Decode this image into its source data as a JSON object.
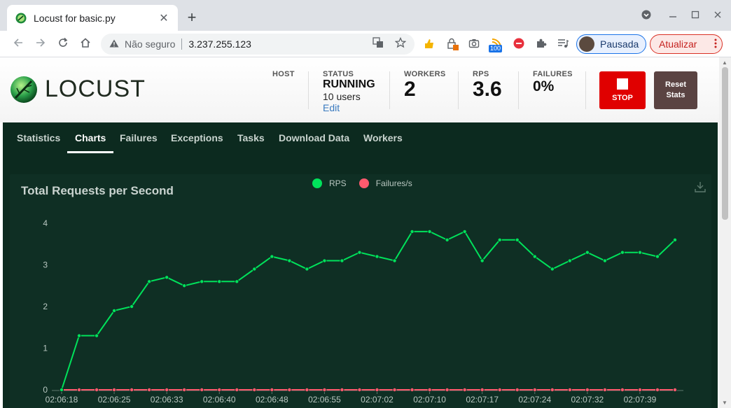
{
  "browser": {
    "tab_title": "Locust for basic.py",
    "tab_close": "✕",
    "new_tab": "+",
    "omnibox": {
      "security_label": "Não seguro",
      "url": "3.237.255.123"
    },
    "ext_badge": "100",
    "profile_label": "Pausada",
    "update_label": "Atualizar"
  },
  "header": {
    "logo_text": "LOCUST",
    "host": {
      "label": "HOST"
    },
    "status": {
      "label": "STATUS",
      "value": "RUNNING",
      "users": "10 users",
      "edit": "Edit"
    },
    "workers": {
      "label": "WORKERS",
      "value": "2"
    },
    "rps": {
      "label": "RPS",
      "value": "3.6"
    },
    "failures": {
      "label": "FAILURES",
      "value": "0%"
    },
    "stop_label": "STOP",
    "reset_label_1": "Reset",
    "reset_label_2": "Stats"
  },
  "nav": {
    "tabs": [
      {
        "label": "Statistics"
      },
      {
        "label": "Charts"
      },
      {
        "label": "Failures"
      },
      {
        "label": "Exceptions"
      },
      {
        "label": "Tasks"
      },
      {
        "label": "Download Data"
      },
      {
        "label": "Workers"
      }
    ],
    "active": "Charts"
  },
  "chart_data": {
    "type": "line",
    "title": "Total Requests per Second",
    "x_tick_labels": [
      "02:06:18",
      "02:06:25",
      "02:06:33",
      "02:06:40",
      "02:06:48",
      "02:06:55",
      "02:07:02",
      "02:07:10",
      "02:07:17",
      "02:07:24",
      "02:07:32",
      "02:07:39"
    ],
    "ylim": [
      0,
      4
    ],
    "y_ticks": [
      0,
      1,
      2,
      3,
      4
    ],
    "legend_position": "top-center",
    "series": [
      {
        "name": "RPS",
        "color": "#00e25b",
        "values": [
          0,
          1.3,
          1.3,
          1.9,
          2.0,
          2.6,
          2.7,
          2.5,
          2.6,
          2.6,
          2.6,
          2.9,
          3.2,
          3.1,
          2.9,
          3.1,
          3.1,
          3.3,
          3.2,
          3.1,
          3.8,
          3.8,
          3.6,
          3.8,
          3.1,
          3.6,
          3.6,
          3.2,
          2.9,
          3.1,
          3.3,
          3.1,
          3.3,
          3.3,
          3.2,
          3.6
        ]
      },
      {
        "name": "Failures/s",
        "color": "#ff5a6e",
        "values": [
          0,
          0,
          0,
          0,
          0,
          0,
          0,
          0,
          0,
          0,
          0,
          0,
          0,
          0,
          0,
          0,
          0,
          0,
          0,
          0,
          0,
          0,
          0,
          0,
          0,
          0,
          0,
          0,
          0,
          0,
          0,
          0,
          0,
          0,
          0,
          0
        ]
      }
    ]
  }
}
